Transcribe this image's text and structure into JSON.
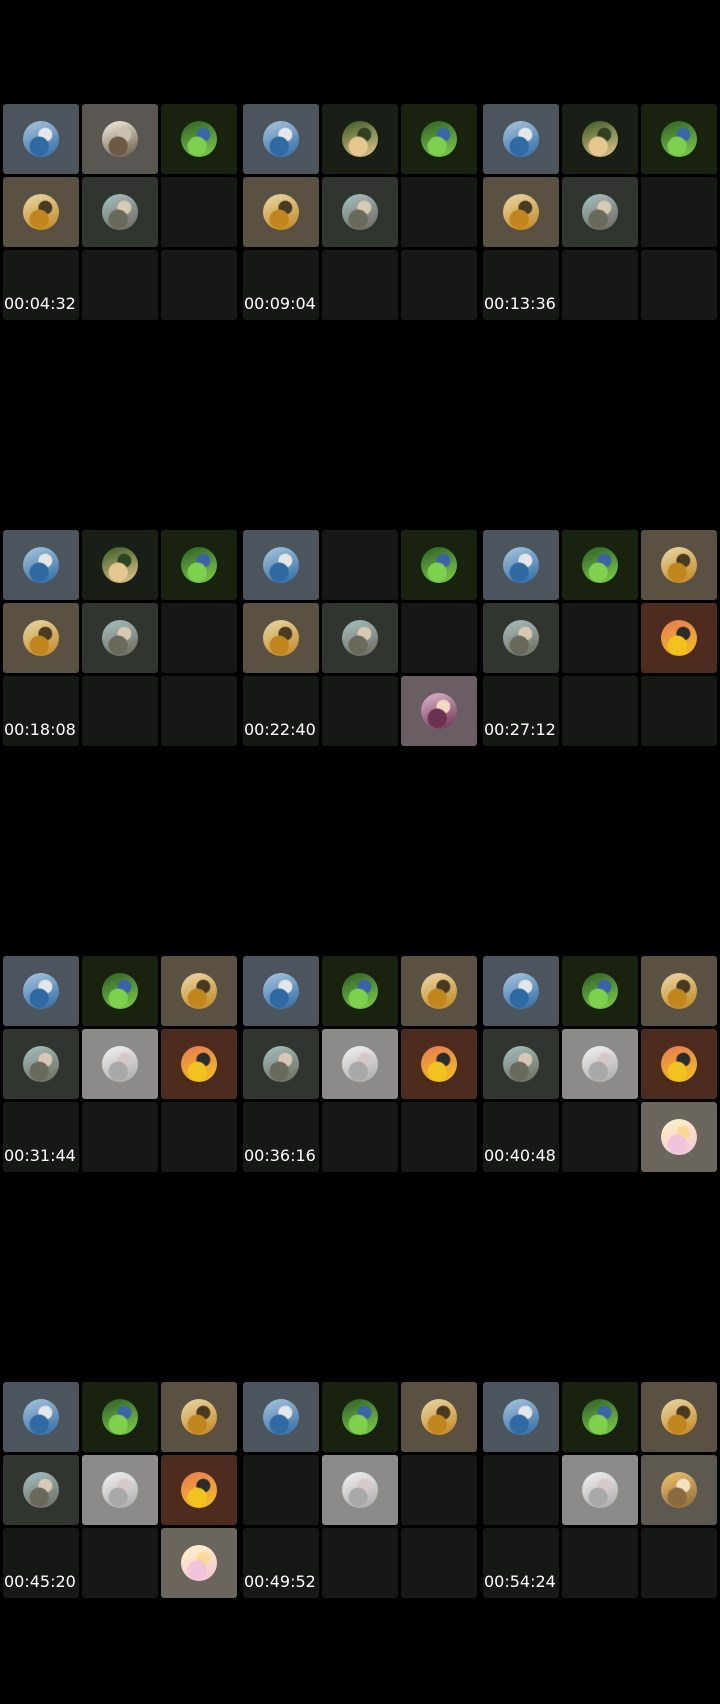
{
  "participants": {
    "sailor": {
      "icon": "sailor-avatar-icon",
      "tile_bg": "#4c555d",
      "avatar": [
        "#a9c6de",
        "#2f6aa3",
        "#e4e6e8"
      ]
    },
    "statue": {
      "icon": "statue-avatar-icon",
      "tile_bg": "#5a5752",
      "avatar": [
        "#f3eee4",
        "#6b5a46",
        "#c9c0b2"
      ]
    },
    "field": {
      "icon": "field-avatar-icon",
      "tile_bg": "#18220f",
      "avatar": [
        "#2f5f26",
        "#7fd14d",
        "#3a63a8"
      ]
    },
    "boat": {
      "icon": "boat-avatar-icon",
      "tile_bg": "#5b5143",
      "avatar": [
        "#e9d8a8",
        "#c2861f",
        "#4b3a22"
      ]
    },
    "woman": {
      "icon": "woman-avatar-icon",
      "tile_bg": "#30352f",
      "avatar": [
        "#a7c0c3",
        "#6a6a5c",
        "#d8c9b4"
      ]
    },
    "soldier": {
      "icon": "soldier-avatar-icon",
      "tile_bg": "#191f16",
      "avatar": [
        "#3a5a26",
        "#e6c78f",
        "#2e4420"
      ]
    },
    "girl": {
      "icon": "girl-avatar-icon",
      "tile_bg": "#6a5d63",
      "avatar": [
        "#e0b8cd",
        "#6c3050",
        "#f2d9c4"
      ]
    },
    "runner": {
      "icon": "runner-avatar-icon",
      "tile_bg": "#4d2b1f",
      "avatar": [
        "#e77a55",
        "#f2c21f",
        "#2b2b2b"
      ]
    },
    "dancer": {
      "icon": "dancer-avatar-icon",
      "tile_bg": "#8c8b89",
      "avatar": [
        "#f3f3f3",
        "#a9a9a9",
        "#d6c8c8"
      ]
    },
    "sphere": {
      "icon": "sphere-avatar-icon",
      "tile_bg": "#6a665e",
      "avatar": [
        "#fff4c6",
        "#f2c4d9",
        "#f9d99b"
      ]
    },
    "child": {
      "icon": "child-avatar-icon",
      "tile_bg": "#5d5950",
      "avatar": [
        "#f0c36b",
        "#8a6a3e",
        "#f6e0c0"
      ]
    }
  },
  "frames": [
    {
      "timestamp": "00:04:32",
      "grid": [
        "sailor",
        "statue",
        "field",
        "boat",
        "woman",
        null,
        null,
        null,
        null
      ]
    },
    {
      "timestamp": "00:09:04",
      "grid": [
        "sailor",
        "soldier",
        "field",
        "boat",
        "woman",
        null,
        null,
        null,
        null
      ]
    },
    {
      "timestamp": "00:13:36",
      "grid": [
        "sailor",
        "soldier",
        "field",
        "boat",
        "woman",
        null,
        null,
        null,
        null
      ]
    },
    {
      "timestamp": "00:18:08",
      "grid": [
        "sailor",
        "soldier",
        "field",
        "boat",
        "woman",
        null,
        null,
        null,
        null
      ]
    },
    {
      "timestamp": "00:22:40",
      "grid": [
        "sailor",
        null,
        "field",
        "boat",
        "woman",
        null,
        null,
        null,
        "girl"
      ]
    },
    {
      "timestamp": "00:27:12",
      "grid": [
        "sailor",
        "field",
        "boat",
        "woman",
        null,
        "runner",
        null,
        null,
        null
      ]
    },
    {
      "timestamp": "00:31:44",
      "grid": [
        "sailor",
        "field",
        "boat",
        "woman",
        "dancer",
        "runner",
        null,
        null,
        null
      ]
    },
    {
      "timestamp": "00:36:16",
      "grid": [
        "sailor",
        "field",
        "boat",
        "woman",
        "dancer",
        "runner",
        null,
        null,
        null
      ]
    },
    {
      "timestamp": "00:40:48",
      "grid": [
        "sailor",
        "field",
        "boat",
        "woman",
        "dancer",
        "runner",
        null,
        null,
        "sphere"
      ]
    },
    {
      "timestamp": "00:45:20",
      "grid": [
        "sailor",
        "field",
        "boat",
        "woman",
        "dancer",
        "runner",
        null,
        null,
        "sphere"
      ]
    },
    {
      "timestamp": "00:49:52",
      "grid": [
        "sailor",
        "field",
        "boat",
        null,
        "dancer",
        null,
        null,
        null,
        null
      ]
    },
    {
      "timestamp": "00:54:24",
      "grid": [
        "sailor",
        "field",
        "boat",
        null,
        "dancer",
        "child",
        null,
        null,
        null
      ]
    }
  ]
}
